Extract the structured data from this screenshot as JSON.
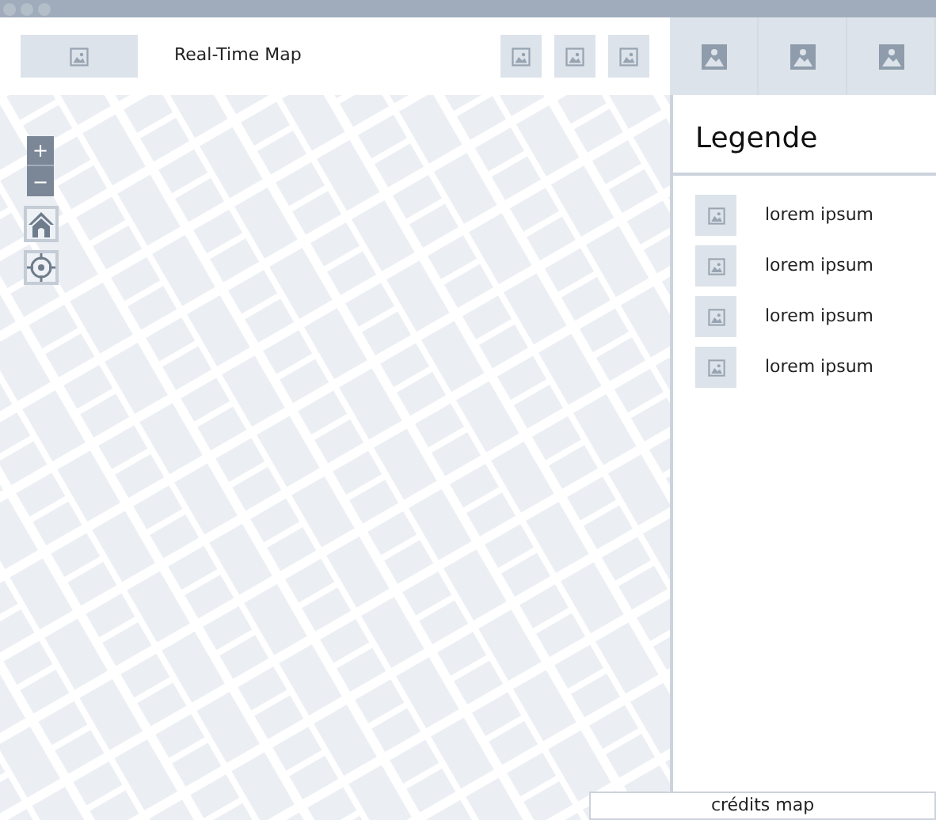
{
  "toolbar": {
    "title": "Real-Time Map"
  },
  "map": {
    "kind": "picture",
    "zoom_in": "+",
    "zoom_out": "−"
  },
  "legend": {
    "title": "Legende",
    "items": [
      {
        "label": "lorem ipsum"
      },
      {
        "label": "lorem ipsum"
      },
      {
        "label": "lorem ipsum"
      },
      {
        "label": "lorem ipsum"
      }
    ]
  },
  "credits": "crédits map"
}
